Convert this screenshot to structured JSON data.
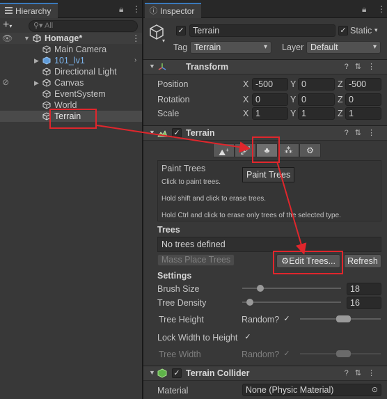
{
  "hierarchy": {
    "tab_label": "Hierarchy",
    "add_label": "+",
    "search_placeholder": "All",
    "scene_name": "Homage*",
    "items": [
      {
        "label": "Main Camera"
      },
      {
        "label": "101_lv1"
      },
      {
        "label": "Directional Light"
      },
      {
        "label": "Canvas"
      },
      {
        "label": "EventSystem"
      },
      {
        "label": "World"
      },
      {
        "label": "Terrain"
      }
    ]
  },
  "inspector": {
    "tab_label": "Inspector",
    "object_name": "Terrain",
    "static_label": "Static",
    "tag_label": "Tag",
    "tag_value": "Terrain",
    "layer_label": "Layer",
    "layer_value": "Default",
    "transform": {
      "title": "Transform",
      "position_label": "Position",
      "rotation_label": "Rotation",
      "scale_label": "Scale",
      "axis_x": "X",
      "axis_y": "Y",
      "axis_z": "Z",
      "position": [
        "-500",
        "0",
        "-500"
      ],
      "rotation": [
        "0",
        "0",
        "0"
      ],
      "scale": [
        "1",
        "1",
        "1"
      ]
    },
    "terrain": {
      "title": "Terrain",
      "help_title": "Paint Trees",
      "help_lines": [
        "Click to paint trees.",
        "Hold shift and click to erase trees.",
        "Hold Ctrl and click to erase only trees of the selected type."
      ],
      "tooltip": "Paint Trees",
      "trees_label": "Trees",
      "no_trees": "No trees defined",
      "mass_place": "Mass Place Trees",
      "edit_trees": "Edit Trees...",
      "refresh": "Refresh",
      "settings_label": "Settings",
      "brush_size_label": "Brush Size",
      "brush_size": "18",
      "brush_size_level": 0.18,
      "tree_density_label": "Tree Density",
      "tree_density": "16",
      "tree_density_level": 0.08,
      "tree_height_label": "Tree Height",
      "random_label": "Random?",
      "lock_width_label": "Lock Width to Height",
      "tree_width_label": "Tree Width",
      "random_label_2": "Random?"
    },
    "collider": {
      "title": "Terrain Collider",
      "material_label": "Material",
      "material_value": "None (Physic Material)"
    }
  },
  "colors": {
    "accent": "#3a79bb",
    "highlight_red": "#e0262c",
    "prefab_blue": "#7cb4ec"
  }
}
